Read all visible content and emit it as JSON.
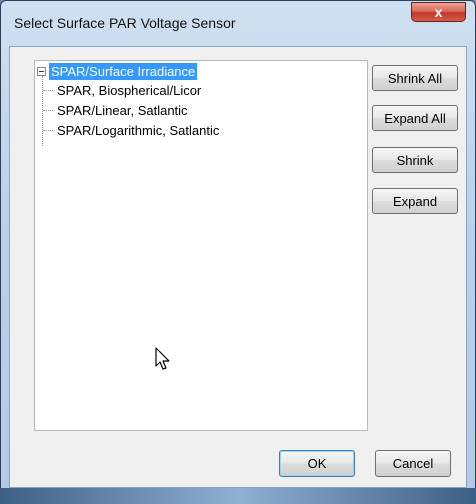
{
  "window": {
    "title": "Select Surface PAR Voltage Sensor",
    "close_glyph": "x"
  },
  "tree": {
    "root": {
      "label": "SPAR/Surface Irradiance",
      "expander_icon": "minus-box-icon",
      "selected": true
    },
    "children": [
      {
        "label": "SPAR, Biospherical/Licor"
      },
      {
        "label": "SPAR/Linear, Satlantic"
      },
      {
        "label": "SPAR/Logarithmic, Satlantic"
      }
    ]
  },
  "side_buttons": {
    "shrink_all": "Shrink All",
    "expand_all": "Expand All",
    "shrink": "Shrink",
    "expand": "Expand"
  },
  "footer": {
    "ok": "OK",
    "cancel": "Cancel"
  },
  "colors": {
    "selection": "#3399ff",
    "close_button": "#c1382a",
    "frame": "#b2cae6"
  },
  "cursor_icon": "arrow-pointer-icon"
}
